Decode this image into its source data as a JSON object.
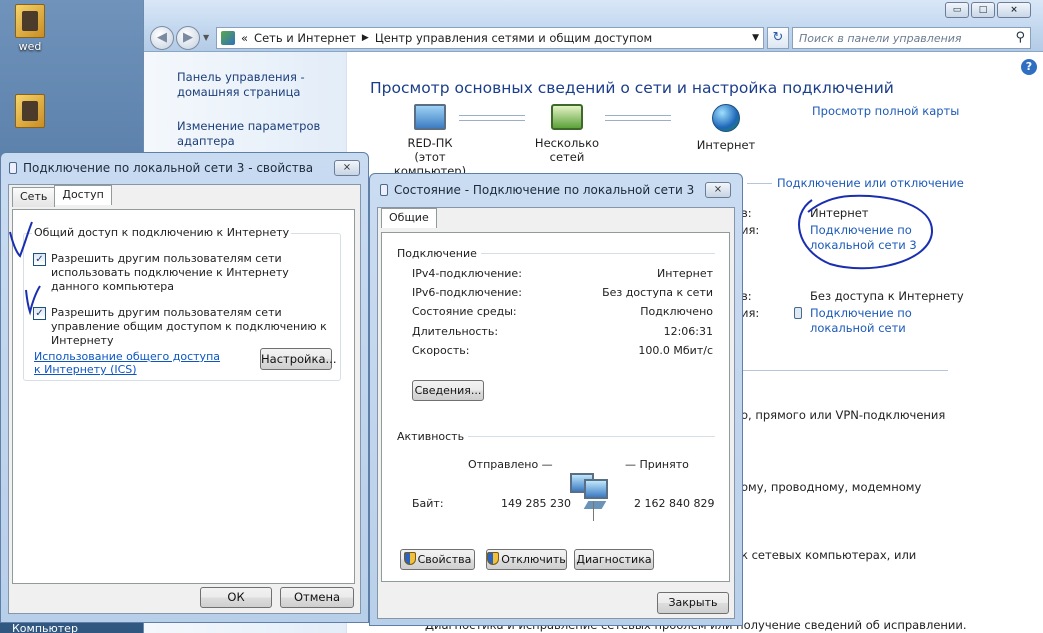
{
  "desktop": {
    "icons": [
      {
        "label": "wed"
      },
      {
        "label": ""
      }
    ],
    "taskbar_item": "Компьютер"
  },
  "control_panel": {
    "caption_buttons": [
      "▭",
      "□",
      "⨯"
    ],
    "address": {
      "prefix": "«",
      "crumb1": "Сеть и Интернет",
      "crumb2": "Центр управления сетями и общим доступом"
    },
    "search_placeholder": "Поиск в панели управления",
    "left_links": [
      "Панель управления - домашняя страница",
      "Изменение параметров адаптера"
    ],
    "title": "Просмотр основных сведений о сети и настройка подключений",
    "full_map_link": "Просмотр полной карты",
    "map": [
      {
        "name": "RED-ПК",
        "sub": "(этот компьютер)"
      },
      {
        "name": "Несколько сетей",
        "sub": ""
      },
      {
        "name": "Интернет",
        "sub": ""
      }
    ],
    "connect_link": "Подключение или отключение",
    "net1": {
      "label1": "в:",
      "label2": "ия:",
      "access": "Интернет",
      "connection": "Подключение по локальной сети 3"
    },
    "net2": {
      "label1": "в:",
      "label2": "ия:",
      "access": "Без доступа к Интернету",
      "connection": "Подключение по локальной сети"
    },
    "fragments": [
      "о, прямого или VPN-подключения",
      "ому, проводному, модемному",
      "к сетевых компьютерах, или",
      "Диагностика и исправление сетевых проблем или получение сведений об исправлении."
    ]
  },
  "props_dialog": {
    "title": "Подключение по локальной сети 3 - свойства",
    "close": "⨯",
    "tabs": [
      "Сеть",
      "Доступ"
    ],
    "group_title": "Общий доступ к подключению к Интернету",
    "check1": "Разрешить другим пользователям сети использовать подключение к Интернету данного компьютера",
    "check2": "Разрешить другим пользователям сети управление общим доступом к подключению к Интернету",
    "check_mark": "✓",
    "ics_link": "Использование общего доступа к Интернету (ICS)",
    "setup_button": "Настройка...",
    "ok_button": "ОК",
    "cancel_button": "Отмена"
  },
  "status_dialog": {
    "title": "Состояние - Подключение по локальной сети 3",
    "close": "⨯",
    "tab": "Общие",
    "connection_section": "Подключение",
    "rows": [
      {
        "label": "IPv4-подключение:",
        "value": "Интернет"
      },
      {
        "label": "IPv6-подключение:",
        "value": "Без доступа к сети"
      },
      {
        "label": "Состояние среды:",
        "value": "Подключено"
      },
      {
        "label": "Длительность:",
        "value": "12:06:31"
      },
      {
        "label": "Скорость:",
        "value": "100.0 Мбит/с"
      }
    ],
    "details_button": "Сведения...",
    "activity_section": "Активность",
    "sent_label": "Отправлено —",
    "received_label": "— Принято",
    "bytes_label": "Байт:",
    "bytes_sent": "149 285 230",
    "bytes_received": "2 162 840 829",
    "properties_button": "Свойства",
    "disable_button": "Отключить",
    "diagnose_button": "Диагностика",
    "close_button": "Закрыть"
  },
  "colors": {
    "link": "#1c5ab7",
    "title": "#1b3e8a",
    "annotation_ink": "#1a2fb0"
  }
}
